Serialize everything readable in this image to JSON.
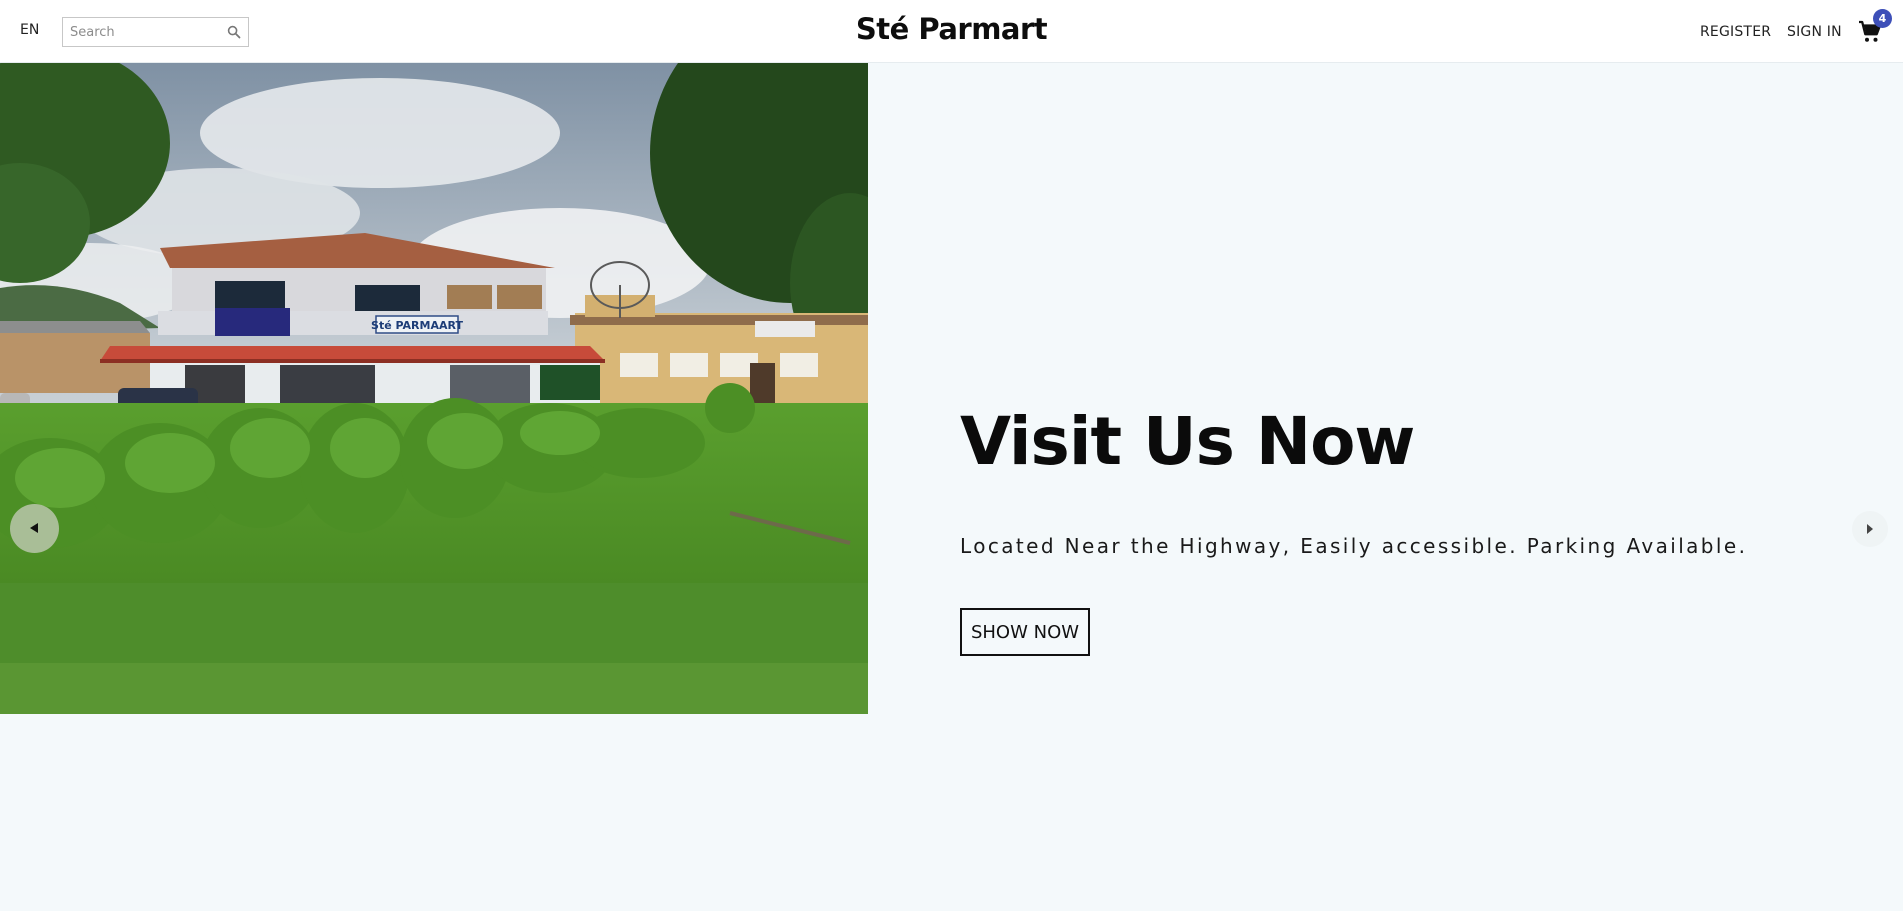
{
  "header": {
    "language": "EN",
    "search": {
      "placeholder": "Search",
      "value": ""
    },
    "brand": "Sté Parmart",
    "nav": {
      "register": "REGISTER",
      "sign_in": "SIGN IN"
    },
    "cart": {
      "icon": "cart-icon",
      "count": "4",
      "badge_color": "#3d4fb8"
    }
  },
  "hero": {
    "image_alt": "Storefront photo",
    "storefront_sign": "Sté PARMAART",
    "title": "Visit Us Now",
    "subtitle": "Located Near the Highway, Easily accessible. Parking Available.",
    "button_label": "SHOW NOW",
    "prev_icon": "chevron-left-icon",
    "next_icon": "chevron-right-icon"
  },
  "colors": {
    "page_background": "#f4f9fb",
    "header_background": "#ffffff",
    "text": "#111111"
  }
}
